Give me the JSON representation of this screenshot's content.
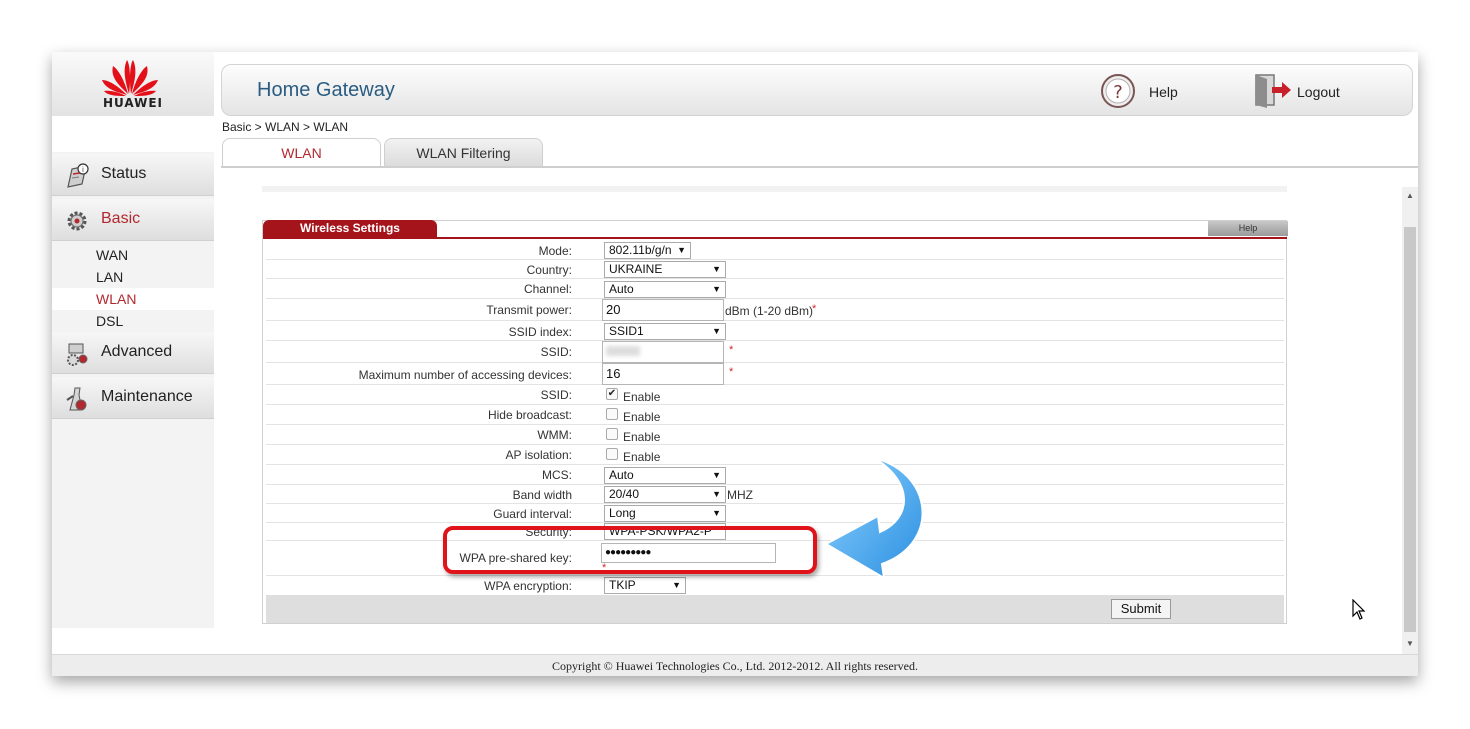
{
  "brand": {
    "name": "HUAWEI",
    "accent": "#b2282e",
    "logo_red": "#e3101a"
  },
  "header": {
    "title": "Home Gateway",
    "help_label": "Help",
    "logout_label": "Logout"
  },
  "breadcrumb": "Basic > WLAN > WLAN",
  "tabs": [
    {
      "label": "WLAN",
      "active": true
    },
    {
      "label": "WLAN Filtering",
      "active": false
    }
  ],
  "sidebar": {
    "menus": [
      {
        "label": "Status",
        "icon": "status-icon"
      },
      {
        "label": "Basic",
        "icon": "gear-icon",
        "active": true
      },
      {
        "label": "Advanced",
        "icon": "advanced-icon"
      },
      {
        "label": "Maintenance",
        "icon": "maintenance-icon"
      }
    ],
    "basic_items": [
      {
        "label": "WAN"
      },
      {
        "label": "LAN"
      },
      {
        "label": "WLAN",
        "active": true
      },
      {
        "label": "DSL"
      }
    ]
  },
  "panel": {
    "title": "Wireless Settings",
    "help": "Help",
    "fields": {
      "mode": {
        "label": "Mode:",
        "value": "802.11b/g/n"
      },
      "country": {
        "label": "Country:",
        "value": "UKRAINE"
      },
      "channel": {
        "label": "Channel:",
        "value": "Auto"
      },
      "transmit_power": {
        "label": "Transmit power:",
        "value": "20",
        "suffix": "dBm (1-20 dBm)",
        "required": "*"
      },
      "ssid_index": {
        "label": "SSID index:",
        "value": "SSID1"
      },
      "ssid_name": {
        "label": "SSID:",
        "value": "",
        "required": "*"
      },
      "max_devices": {
        "label": "Maximum number of accessing devices:",
        "value": "16",
        "required": "*"
      },
      "ssid_enable": {
        "label": "SSID:",
        "option": "Enable",
        "checked": true
      },
      "hide_broadcast": {
        "label": "Hide broadcast:",
        "option": "Enable",
        "checked": false
      },
      "wmm": {
        "label": "WMM:",
        "option": "Enable",
        "checked": false
      },
      "ap_isolation": {
        "label": "AP isolation:",
        "option": "Enable",
        "checked": false
      },
      "mcs": {
        "label": "MCS:",
        "value": "Auto"
      },
      "band_width": {
        "label": "Band width",
        "value": "20/40",
        "suffix": "MHZ"
      },
      "guard_interval": {
        "label": "Guard interval:",
        "value": "Long"
      },
      "security": {
        "label": "Security:",
        "value": "WPA-PSK/WPA2-P"
      },
      "wpa_key": {
        "label": "WPA pre-shared key:",
        "value": "●●●●●●●●●",
        "required": "*"
      },
      "wpa_encryption": {
        "label": "WPA encryption:",
        "value": "TKIP"
      }
    },
    "submit": "Submit"
  },
  "footer": "Copyright © Huawei Technologies Co., Ltd. 2012-2012. All rights reserved."
}
